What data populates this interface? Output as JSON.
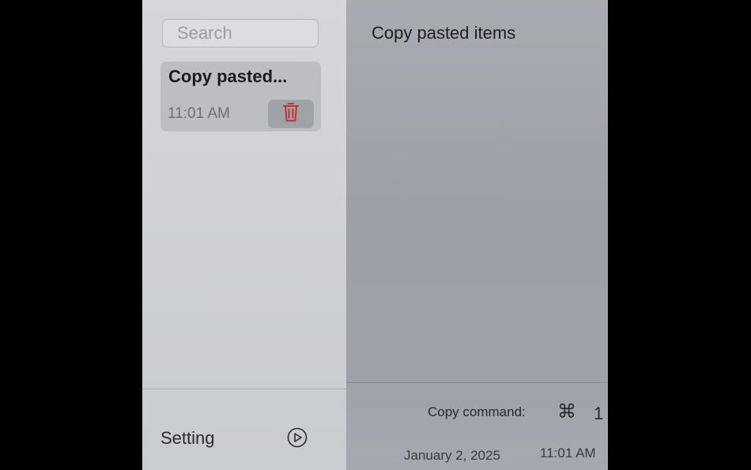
{
  "sidebar": {
    "search": {
      "placeholder": "Search"
    },
    "notes": [
      {
        "title": "Copy pasted...",
        "time": "11:01 AM",
        "delete_icon": "trash-icon",
        "delete_color": "#c4302b"
      }
    ],
    "footer": {
      "setting_label": "Setting",
      "setting_icon": "play-circle-icon"
    }
  },
  "detail": {
    "title": "Copy pasted items",
    "copy_command": {
      "label": "Copy command:",
      "key_symbol": "⌘",
      "key_number": "1"
    },
    "date": "January 2, 2025",
    "time": "11:01 AM"
  }
}
